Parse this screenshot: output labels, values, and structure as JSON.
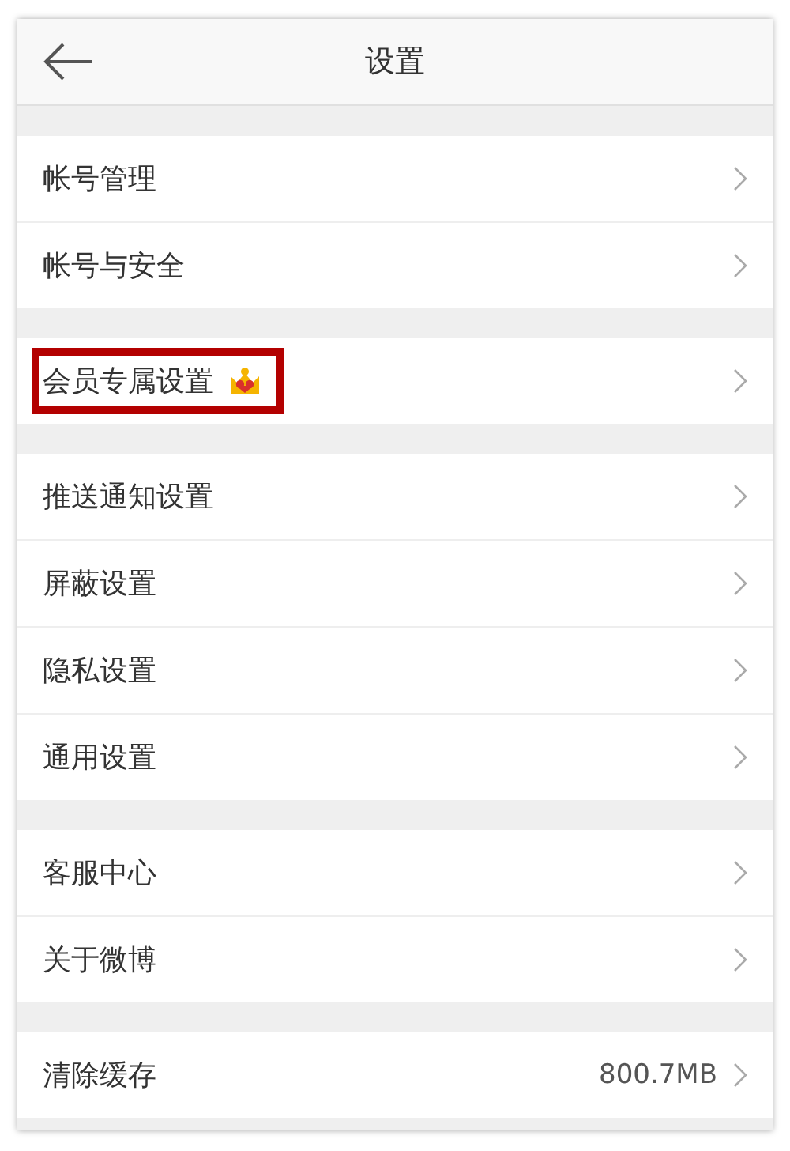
{
  "header": {
    "title": "设置"
  },
  "groups": [
    {
      "items": [
        {
          "label": "帐号管理",
          "highlighted": false,
          "badge": false
        },
        {
          "label": "帐号与安全",
          "highlighted": false,
          "badge": false
        }
      ]
    },
    {
      "items": [
        {
          "label": "会员专属设置",
          "highlighted": true,
          "badge": true
        }
      ]
    },
    {
      "items": [
        {
          "label": "推送通知设置",
          "highlighted": false,
          "badge": false
        },
        {
          "label": "屏蔽设置",
          "highlighted": false,
          "badge": false
        },
        {
          "label": "隐私设置",
          "highlighted": false,
          "badge": false
        },
        {
          "label": "通用设置",
          "highlighted": false,
          "badge": false
        }
      ]
    },
    {
      "items": [
        {
          "label": "客服中心",
          "highlighted": false,
          "badge": false
        },
        {
          "label": "关于微博",
          "highlighted": false,
          "badge": false
        }
      ]
    },
    {
      "items": [
        {
          "label": "清除缓存",
          "value": "800.7MB",
          "highlighted": false,
          "badge": false
        }
      ]
    }
  ]
}
